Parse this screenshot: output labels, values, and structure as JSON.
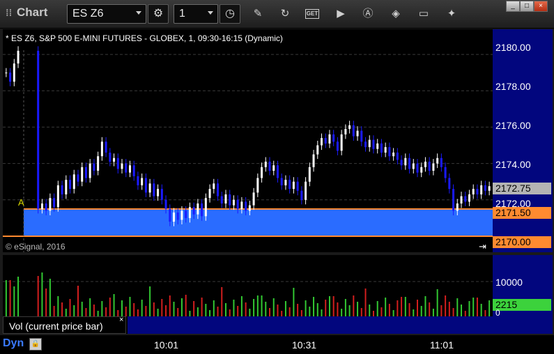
{
  "toolbar": {
    "title": "Chart",
    "symbol": "ES Z6",
    "interval": "1",
    "icons": [
      "settings-gear-icon",
      "clock-icon",
      "pencil-icon",
      "refresh-icon",
      "get-icon",
      "play-icon",
      "search-a-icon",
      "tag-icon",
      "message-icon",
      "twitter-icon"
    ],
    "get_label": "GET"
  },
  "window_buttons": [
    "_",
    "□",
    "×"
  ],
  "price_pane": {
    "header": "* ES Z6, S&P 500 E-MINI FUTURES - GLOBEX, 1, 09:30-16:15 (Dynamic)",
    "watermark": "© eSignal, 2016",
    "marker": "A",
    "axis_labels": [
      "2180.00",
      "2178.00",
      "2176.00",
      "2174.00",
      "2172.00"
    ],
    "last_price": "2172.75",
    "band_top": "2171.50",
    "band_bottom": "2170.00"
  },
  "volume_pane": {
    "axis_label": "10000",
    "current": "2215",
    "zero_label": "0",
    "study_label": "Vol (current price bar)",
    "close_symbol": "×"
  },
  "footer": {
    "dyn_label": "Dyn",
    "times": [
      "10:01",
      "10:31",
      "11:01"
    ]
  },
  "chart_data": {
    "type": "candlestick",
    "y_range": [
      2169.5,
      2181.0
    ],
    "colors": {
      "up": "#ffffff",
      "down": "#1a1aff",
      "band": "#2a6cff",
      "band_edge": "#ff8a30",
      "vol_up": "#32c832",
      "vol_down": "#d21e1e"
    },
    "closes": [
      2179.0,
      2178.5,
      2179.5,
      2180.2,
      null,
      null,
      null,
      null,
      2171.5,
      2171.8,
      2171.4,
      2172.1,
      2171.6,
      2172.8,
      2172.3,
      2173.1,
      2172.6,
      2173.4,
      2173.0,
      2173.8,
      2173.2,
      2174.0,
      2173.6,
      2174.4,
      2175.2,
      2174.6,
      2174.1,
      2174.3,
      2173.7,
      2174.0,
      2173.5,
      2173.9,
      2173.3,
      2172.8,
      2173.2,
      2172.4,
      2172.9,
      2172.2,
      2172.6,
      2172.0,
      2171.5,
      2170.8,
      2171.3,
      2170.9,
      2171.4,
      2171.0,
      2171.6,
      2171.2,
      2171.8,
      2171.1,
      2172.1,
      2172.6,
      2172.9,
      2172.2,
      2171.8,
      2172.3,
      2171.7,
      2172.0,
      2171.5,
      2171.9,
      2171.4,
      2171.7,
      2172.4,
      2173.2,
      2173.8,
      2174.1,
      2173.6,
      2173.9,
      2173.2,
      2172.8,
      2173.1,
      2172.6,
      2173.0,
      2172.5,
      2172.0,
      2173.0,
      2173.8,
      2174.5,
      2175.0,
      2175.4,
      2175.1,
      2175.6,
      2175.2,
      2174.7,
      2175.6,
      2175.9,
      2176.1,
      2175.5,
      2175.8,
      2175.2,
      2174.9,
      2175.3,
      2174.8,
      2175.1,
      2174.6,
      2174.9,
      2174.4,
      2174.6,
      2174.2,
      2173.9,
      2174.3,
      2173.7,
      2174.0,
      2173.5,
      2173.8,
      2174.1,
      2173.6,
      2174.0,
      2174.3,
      2173.8,
      2173.2,
      2172.6,
      2171.4,
      2171.8,
      2172.2,
      2171.9,
      2172.3,
      2172.6,
      2172.3,
      2172.8,
      2172.5,
      2172.75
    ],
    "volume_axis": [
      "10000",
      "2215",
      "0"
    ],
    "time_axis": [
      "10:01",
      "10:31",
      "11:01"
    ]
  }
}
